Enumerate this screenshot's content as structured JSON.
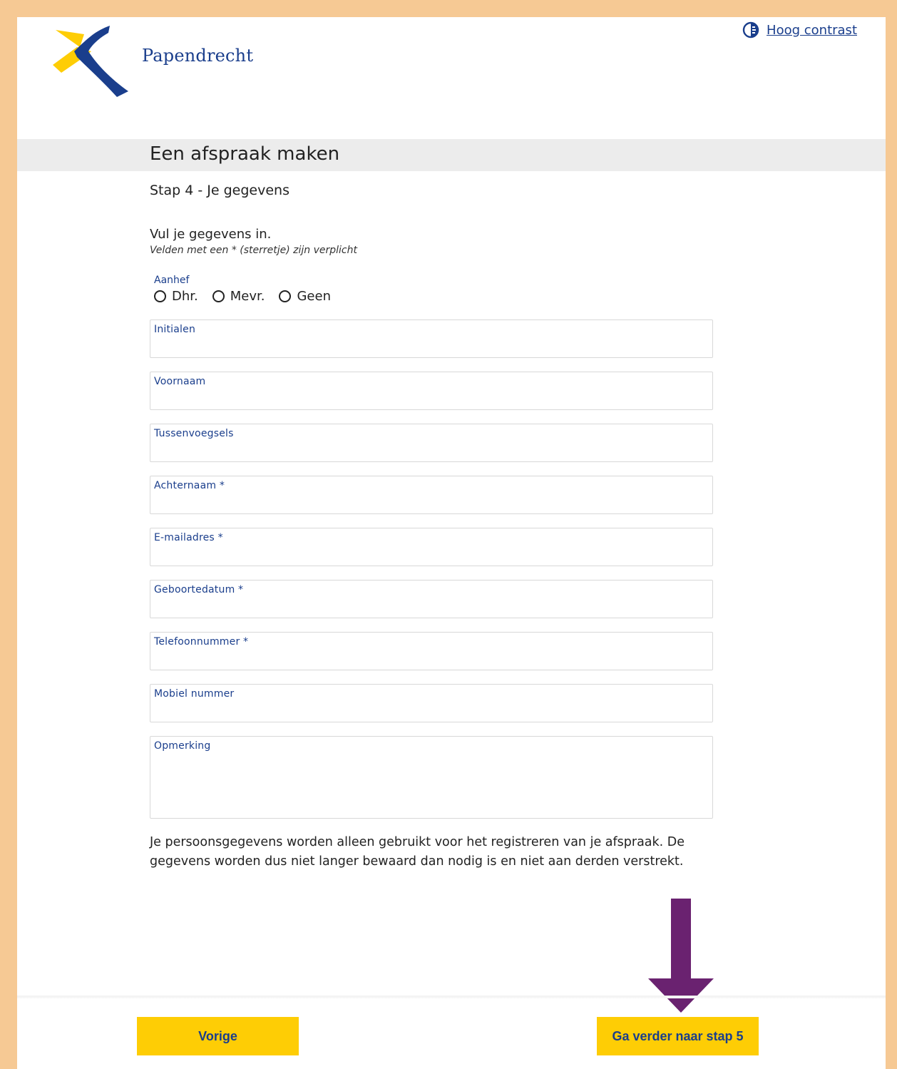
{
  "header": {
    "logo_text": "Papendrecht",
    "contrast_label": "Hoog contrast"
  },
  "page": {
    "title": "Een afspraak maken",
    "step_title": "Stap 4 - Je gegevens",
    "intro": "Vul je gegevens in.",
    "required_note": "Velden met een * (sterretje) zijn verplicht"
  },
  "salutation": {
    "label": "Aanhef",
    "options": [
      "Dhr.",
      "Mevr.",
      "Geen"
    ]
  },
  "fields": {
    "initials": "Initialen",
    "first_name": "Voornaam",
    "infix": "Tussenvoegsels",
    "last_name": "Achternaam *",
    "email": "E-mailadres *",
    "birthdate": "Geboortedatum *",
    "phone": "Telefoonnummer *",
    "mobile": "Mobiel nummer",
    "remark": "Opmerking"
  },
  "privacy_text": "Je persoonsgegevens worden alleen gebruikt voor het registreren van je afspraak. De gegevens worden dus niet langer bewaard dan nodig is en niet aan derden verstrekt.",
  "buttons": {
    "previous": "Vorige",
    "next": "Ga verder naar stap 5"
  },
  "colors": {
    "frame": "#f6c994",
    "brand_blue": "#1a3e8c",
    "brand_yellow": "#fecd05",
    "arrow": "#6a2270",
    "title_band": "#ececec"
  }
}
